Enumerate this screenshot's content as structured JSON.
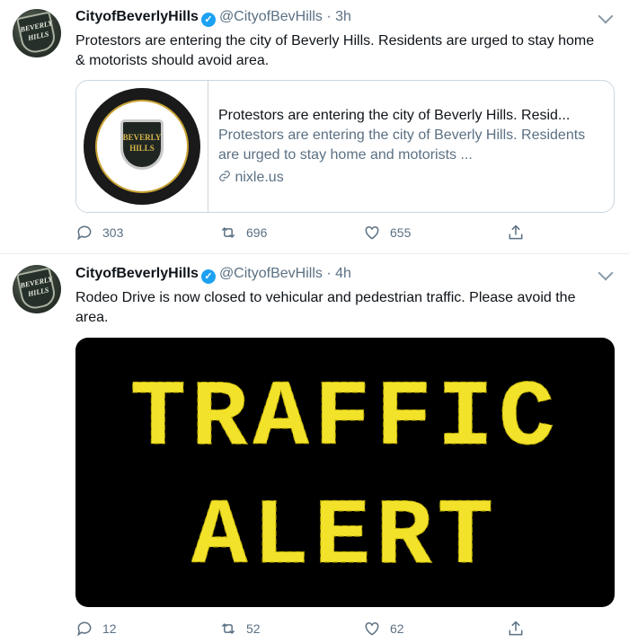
{
  "tweets": [
    {
      "name": "CityofBeverlyHills",
      "handle": "@CityofBevHills",
      "time": "· 3h",
      "text": "Protestors are entering the city of Beverly Hills. Residents are urged to stay home & motorists should avoid area.",
      "avatar_text": "BEVERLY HILLS",
      "card": {
        "title": "Protestors are entering the city of Beverly Hills. Resid...",
        "desc": "Protestors are entering the city of Beverly Hills. Residents are urged to stay home and motorists ...",
        "link": "nixle.us",
        "seal_text": "BEVERLY HILLS"
      },
      "replies": "303",
      "retweets": "696",
      "likes": "655"
    },
    {
      "name": "CityofBeverlyHills",
      "handle": "@CityofBevHills",
      "time": "· 4h",
      "text": "Rodeo Drive is now closed to vehicular and pedestrian traffic. Please avoid the area.",
      "avatar_text": "BEVERLY HILLS",
      "media": {
        "line1": "TRAFFIC",
        "line2": "ALERT",
        "led_color": "#f2e22a"
      },
      "replies": "12",
      "retweets": "52",
      "likes": "62"
    }
  ],
  "colors": {
    "accent": "#1da1f2",
    "secondary_text": "#5b7083"
  },
  "icons": [
    "verified-badge-icon",
    "chevron-down-icon",
    "reply-icon",
    "retweet-icon",
    "like-icon",
    "share-icon",
    "link-icon"
  ]
}
